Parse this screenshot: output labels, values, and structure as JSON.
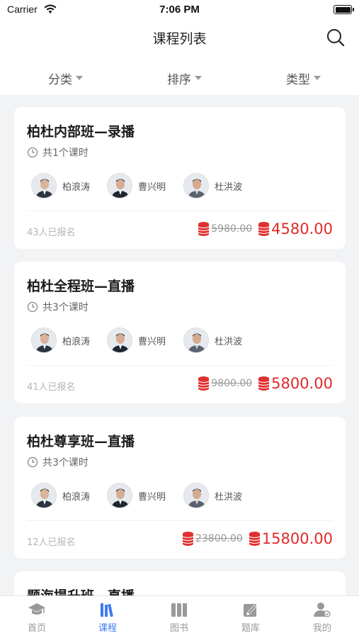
{
  "status_bar": {
    "carrier": "Carrier",
    "time": "7:06 PM"
  },
  "nav": {
    "title": "课程列表"
  },
  "filters": [
    {
      "label": "分类"
    },
    {
      "label": "排序"
    },
    {
      "label": "类型"
    }
  ],
  "courses": [
    {
      "title": "柏杜内部班—录播",
      "lessons": "共1个课时",
      "teachers": [
        "柏浪涛",
        "曹兴明",
        "杜洪波"
      ],
      "enrolled": "43人已报名",
      "original_price": "5980.00",
      "sale_price": "4580.00"
    },
    {
      "title": "柏杜全程班—直播",
      "lessons": "共3个课时",
      "teachers": [
        "柏浪涛",
        "曹兴明",
        "杜洪波"
      ],
      "enrolled": "41人已报名",
      "original_price": "9800.00",
      "sale_price": "5800.00"
    },
    {
      "title": "柏杜尊享班—直播",
      "lessons": "共3个课时",
      "teachers": [
        "柏浪涛",
        "曹兴明",
        "杜洪波"
      ],
      "enrolled": "12人已报名",
      "original_price": "23800.00",
      "sale_price": "15800.00"
    },
    {
      "title": "题海提升班—直播"
    }
  ],
  "tabs": [
    {
      "label": "首页",
      "icon": "graduation-cap-icon"
    },
    {
      "label": "课程",
      "icon": "books-icon",
      "active": true
    },
    {
      "label": "图书",
      "icon": "book-stack-icon"
    },
    {
      "label": "题库",
      "icon": "edit-icon"
    },
    {
      "label": "我的",
      "icon": "user-icon"
    }
  ],
  "colors": {
    "accent": "#3d7bf2",
    "price_red": "#e02a2a",
    "inactive": "#999999"
  }
}
